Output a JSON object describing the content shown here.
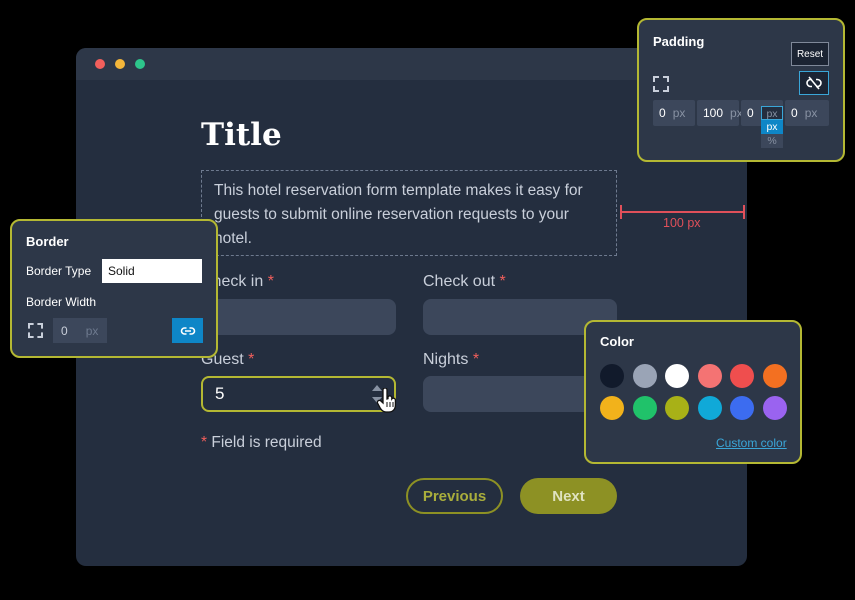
{
  "window": {
    "controls": [
      "close",
      "minimize",
      "maximize"
    ]
  },
  "form": {
    "title": "Title",
    "description": "This hotel reservation form template makes it easy for guests to submit online reservation requests to your hotel.",
    "check_in_label": "Check in",
    "check_out_label": "Check out",
    "guest_label": "Guest",
    "guest_value": "5",
    "nights_label": "Nights",
    "required_mark": "*",
    "required_note": "Field is required",
    "previous_label": "Previous",
    "next_label": "Next"
  },
  "measurement": {
    "label": "100 px"
  },
  "padding_panel": {
    "title": "Padding",
    "reset_label": "Reset",
    "icons": [
      "padding-frame-icon",
      "unlink-icon"
    ],
    "values": [
      {
        "value": "0",
        "unit": "px"
      },
      {
        "value": "100",
        "unit": "px"
      },
      {
        "value": "0",
        "unit": "px"
      },
      {
        "value": "0",
        "unit": "px"
      }
    ],
    "unit_options": [
      "px",
      "px",
      "%"
    ]
  },
  "border_panel": {
    "title": "Border",
    "type_label": "Border Type",
    "type_value": "Solid",
    "width_label": "Border Width",
    "width_value": "0",
    "width_unit": "px",
    "icons": [
      "border-frame-icon",
      "link-icon"
    ]
  },
  "color_panel": {
    "title": "Color",
    "swatches": [
      "#111a2b",
      "#9aa4b6",
      "#ffffff",
      "#f47373",
      "#ef4e4e",
      "#f37021",
      "#f2b21b",
      "#20c26a",
      "#a8b117",
      "#10a9d8",
      "#3c6cf0",
      "#9a63f0"
    ],
    "custom_label": "Custom color"
  },
  "colors": {
    "accent": "#b4b833",
    "button": "#8d9124",
    "link": "#3aa6d8",
    "required": "#f25f5c"
  }
}
